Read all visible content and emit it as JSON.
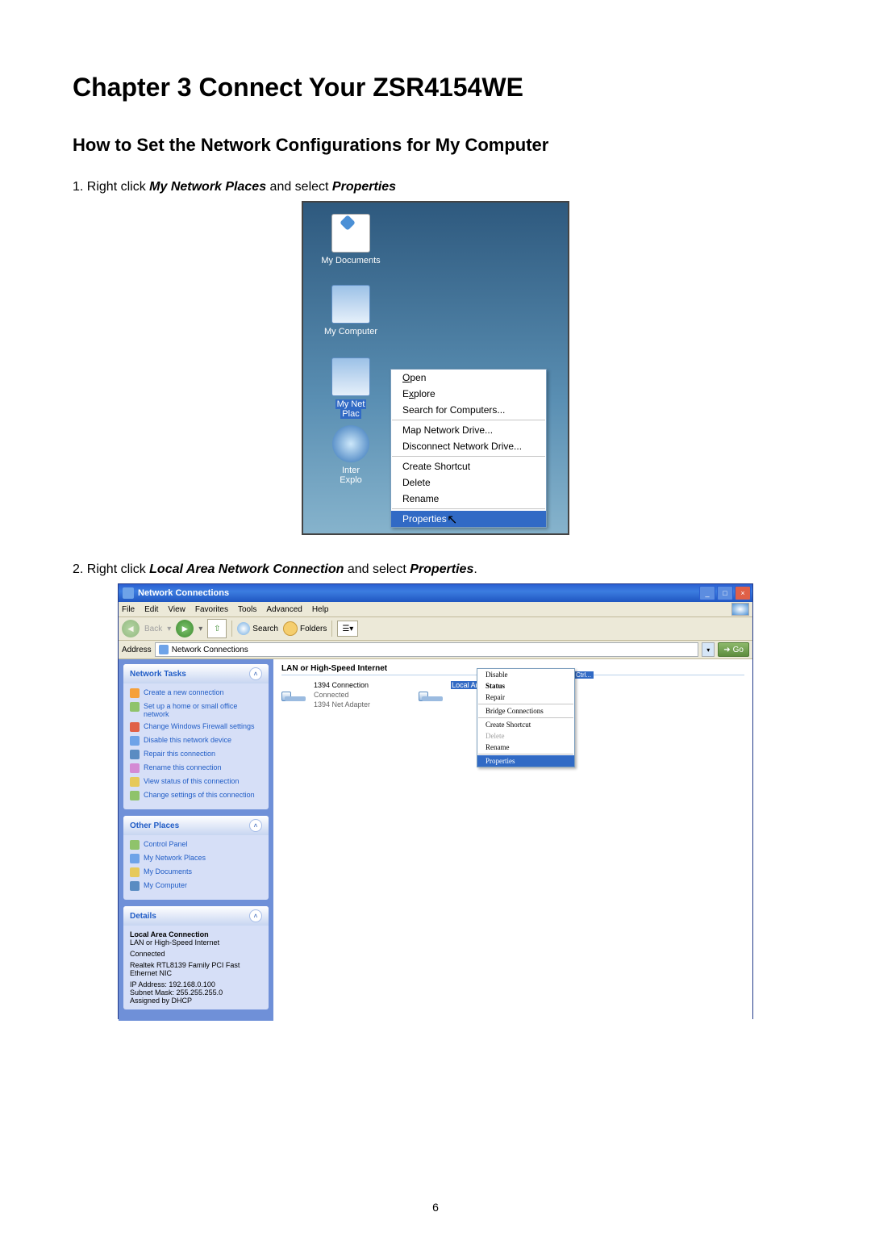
{
  "heading": "Chapter 3 Connect Your ZSR4154WE",
  "subheading": "How to Set the Network Configurations for My Computer",
  "step1": {
    "lead": "1. Right click ",
    "b1": "My Network Places",
    "mid": " and select ",
    "b2": "Properties"
  },
  "step2": {
    "lead": "2. Right click ",
    "b1": "Local Area Network Connection",
    "mid": " and select ",
    "b2": "Properties",
    "tail": "."
  },
  "page_number": "6",
  "shot1": {
    "desktop": {
      "my_documents": "My Documents",
      "my_computer": "My Computer",
      "my_network_prefix": "My Net",
      "my_network_suffix": "Plac",
      "ie_prefix": "Inter",
      "ie_suffix": "Explo"
    },
    "menu": {
      "open": "Open",
      "explore": "Explore",
      "search": "Search for Computers...",
      "map": "Map Network Drive...",
      "disconnect": "Disconnect Network Drive...",
      "shortcut": "Create Shortcut",
      "delete": "Delete",
      "rename": "Rename",
      "properties": "Properties"
    }
  },
  "shot2": {
    "title": "Network Connections",
    "menubar": [
      "File",
      "Edit",
      "View",
      "Favorites",
      "Tools",
      "Advanced",
      "Help"
    ],
    "toolbar": {
      "back": "Back",
      "search": "Search",
      "folders": "Folders"
    },
    "addressbar": {
      "label": "Address",
      "value": "Network Connections",
      "go": "Go"
    },
    "group_header": "LAN or High-Speed Internet",
    "conn1": {
      "name": "1394 Connection",
      "status": "Connected",
      "device": "1394 Net Adapter"
    },
    "conn2": {
      "name": "Local Area Connection"
    },
    "ctrl_hint": "Ctrl...",
    "ctx": {
      "disable": "Disable",
      "status": "Status",
      "repair": "Repair",
      "bridge": "Bridge Connections",
      "shortcut": "Create Shortcut",
      "delete": "Delete",
      "rename": "Rename",
      "properties": "Properties"
    },
    "panels": {
      "tasks": {
        "title": "Network Tasks",
        "items": [
          "Create a new connection",
          "Set up a home or small office network",
          "Change Windows Firewall settings",
          "Disable this network device",
          "Repair this connection",
          "Rename this connection",
          "View status of this connection",
          "Change settings of this connection"
        ]
      },
      "places": {
        "title": "Other Places",
        "items": [
          "Control Panel",
          "My Network Places",
          "My Documents",
          "My Computer"
        ]
      },
      "details": {
        "title": "Details",
        "name": "Local Area Connection",
        "type": "LAN or High-Speed Internet",
        "status": "Connected",
        "device": "Realtek RTL8139 Family PCI Fast Ethernet NIC",
        "ip": "IP Address: 192.168.0.100",
        "mask": "Subnet Mask: 255.255.255.0",
        "dhcp": "Assigned by DHCP"
      }
    }
  }
}
